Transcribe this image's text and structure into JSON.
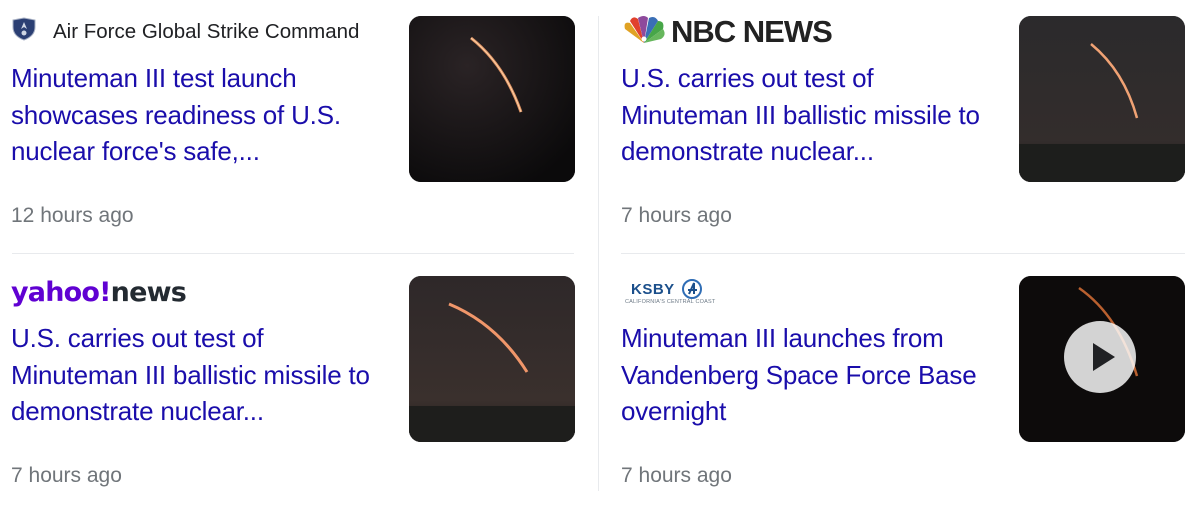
{
  "cards": [
    {
      "source": "Air Force Global Strike Command",
      "headline": "Minuteman III test launch showcases readiness of U.S. nuclear force's safe,...",
      "time": "12 hours ago"
    },
    {
      "source": "NBC NEWS",
      "headline": "U.S. carries out test of Minuteman III ballistic missile to demonstrate nuclear...",
      "time": "7 hours ago"
    },
    {
      "source_parts": [
        "yahoo",
        "!",
        "news"
      ],
      "headline": "U.S. carries out test of Minuteman III ballistic missile to demonstrate nuclear...",
      "time": "7 hours ago"
    },
    {
      "source": "KSBY",
      "source_tagline": "CALIFORNIA'S CENTRAL COAST",
      "headline": "Minuteman III launches from Vandenberg Space Force Base overnight",
      "time": "7 hours ago"
    }
  ],
  "colors": {
    "headline": "#1a0dab",
    "time": "#70757a",
    "yahoo": "#6001d2"
  },
  "icons": {
    "afgsc": "air-force-shield-icon",
    "nbc": "nbc-peacock-icon",
    "play": "play-icon"
  }
}
